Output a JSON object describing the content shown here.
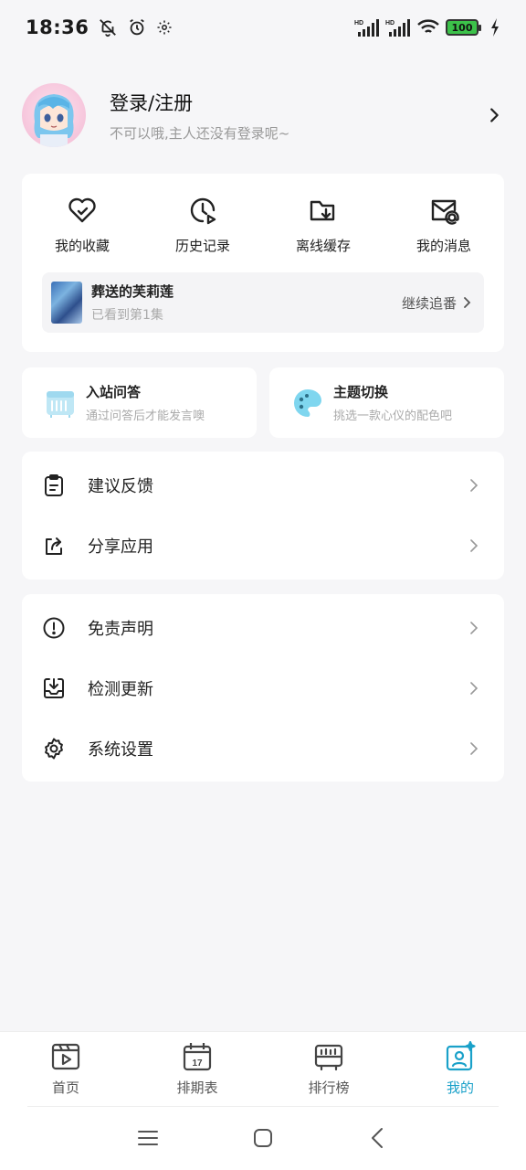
{
  "status_bar": {
    "time": "18:36",
    "icons": [
      "bell-off-icon",
      "alarm-icon",
      "gear-icon",
      "hd-signal-icon",
      "hd-signal-icon",
      "wifi-icon",
      "battery-icon",
      "charging-icon"
    ],
    "battery": "100",
    "battery_color": "#3cc24a"
  },
  "profile": {
    "title": "登录/注册",
    "subtitle": "不可以哦,主人还没有登录呢~"
  },
  "quick_actions": [
    {
      "label": "我的收藏",
      "icon": "heart-icon"
    },
    {
      "label": "历史记录",
      "icon": "history-icon"
    },
    {
      "label": "离线缓存",
      "icon": "download-folder-icon"
    },
    {
      "label": "我的消息",
      "icon": "mail-icon"
    }
  ],
  "continue_watching": {
    "title": "葬送的芙莉莲",
    "progress": "已看到第1集",
    "action": "继续追番"
  },
  "feature_cards": [
    {
      "title": "入站问答",
      "subtitle": "通过问答后才能发言噢",
      "icon": "quiz-icon"
    },
    {
      "title": "主题切换",
      "subtitle": "挑选一款心仪的配色吧",
      "icon": "palette-icon"
    }
  ],
  "menu_group_1": [
    {
      "label": "建议反馈",
      "icon": "clipboard-icon"
    },
    {
      "label": "分享应用",
      "icon": "share-icon"
    }
  ],
  "menu_group_2": [
    {
      "label": "免责声明",
      "icon": "alert-icon"
    },
    {
      "label": "检测更新",
      "icon": "update-icon"
    },
    {
      "label": "系统设置",
      "icon": "gear-icon"
    }
  ],
  "bottom_nav": [
    {
      "label": "首页",
      "icon": "home-video-icon"
    },
    {
      "label": "排期表",
      "icon": "calendar-icon",
      "calendar_day": "17"
    },
    {
      "label": "排行榜",
      "icon": "ranking-icon"
    },
    {
      "label": "我的",
      "icon": "profile-icon",
      "active": true
    }
  ],
  "colors": {
    "accent": "#1aa1c9",
    "background": "#f6f6f8",
    "card": "#ffffff",
    "quiz_icon": "#bfe7f5",
    "palette_icon": "#7fd6ef"
  }
}
